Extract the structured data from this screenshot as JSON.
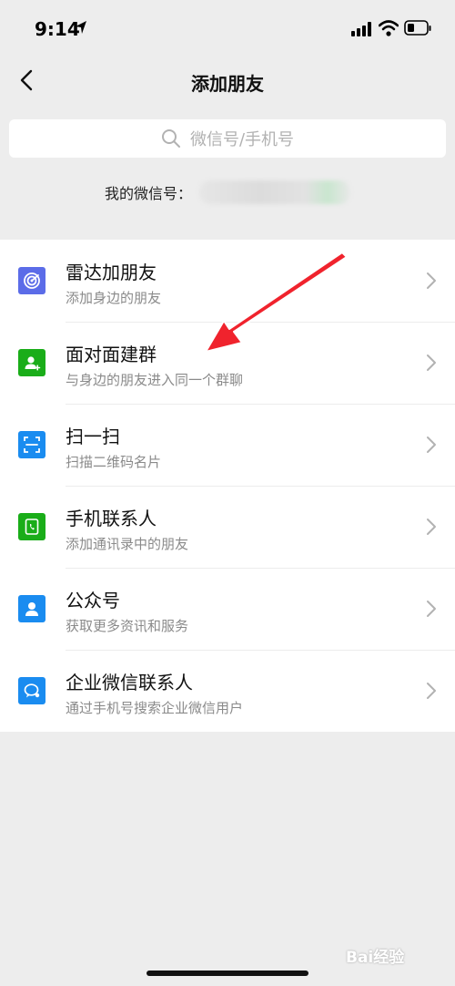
{
  "status_bar": {
    "time": "9:14"
  },
  "nav": {
    "title": "添加朋友"
  },
  "search": {
    "placeholder": "微信号/手机号"
  },
  "my_id": {
    "label": "我的微信号："
  },
  "menu": {
    "items": [
      {
        "title": "雷达加朋友",
        "subtitle": "添加身边的朋友",
        "icon": "radar-icon",
        "color": "#5b6ce8"
      },
      {
        "title": "面对面建群",
        "subtitle": "与身边的朋友进入同一个群聊",
        "icon": "face-to-face-group-icon",
        "color": "#1aad19"
      },
      {
        "title": "扫一扫",
        "subtitle": "扫描二维码名片",
        "icon": "scan-icon",
        "color": "#1a8cf0"
      },
      {
        "title": "手机联系人",
        "subtitle": "添加通讯录中的朋友",
        "icon": "phone-contacts-icon",
        "color": "#1aad19"
      },
      {
        "title": "公众号",
        "subtitle": "获取更多资讯和服务",
        "icon": "official-account-icon",
        "color": "#1a8cf0"
      },
      {
        "title": "企业微信联系人",
        "subtitle": "通过手机号搜索企业微信用户",
        "icon": "work-wechat-icon",
        "color": "#1a8cf0"
      }
    ]
  },
  "watermark": {
    "text": "Bai经验"
  },
  "colors": {
    "background": "#ededed",
    "annotation_arrow": "#f0232d"
  }
}
